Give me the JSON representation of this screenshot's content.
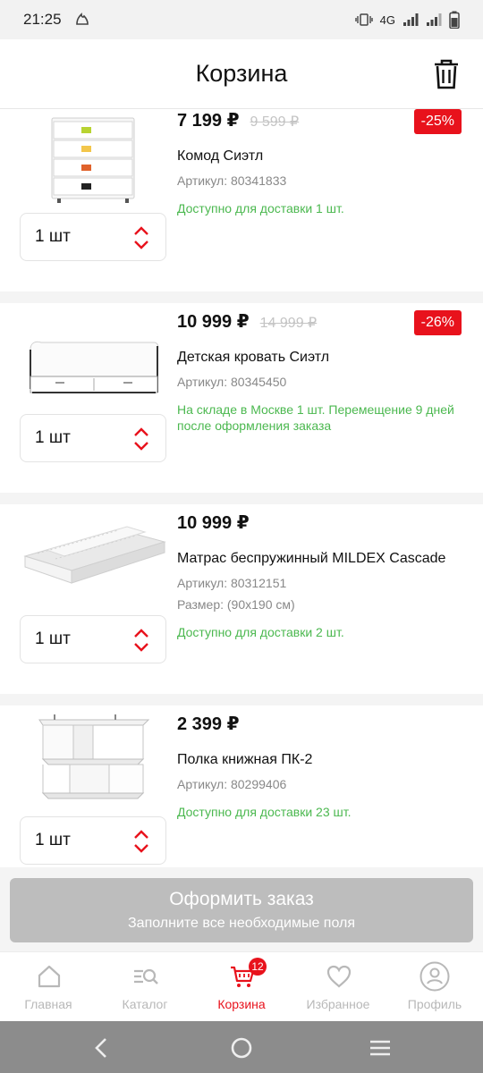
{
  "status_bar": {
    "time": "21:25",
    "network": "4G"
  },
  "header": {
    "title": "Корзина"
  },
  "items": [
    {
      "price": "7 199 ₽",
      "old_price": "9 599 ₽",
      "discount": "-25%",
      "name": "Комод Сиэтл",
      "article": "Артикул: 80341833",
      "availability": "Доступно для доставки 1 шт.",
      "quantity": "1 шт"
    },
    {
      "price": "10 999 ₽",
      "old_price": "14 999 ₽",
      "discount": "-26%",
      "name": "Детская кровать Сиэтл",
      "article": "Артикул: 80345450",
      "availability": "На складе в Москве 1 шт. Перемещение  9 дней после оформления заказа",
      "quantity": "1 шт"
    },
    {
      "price": "10 999 ₽",
      "name": "Матрас беспружинный MILDEX Cascade",
      "article": "Артикул: 80312151",
      "size": "Размер: (90х190 см)",
      "availability": "Доступно для доставки 2 шт.",
      "quantity": "1 шт"
    },
    {
      "price": "2 399 ₽",
      "name": "Полка книжная ПК-2",
      "article": "Артикул: 80299406",
      "availability": "Доступно для доставки 23 шт.",
      "quantity": "1 шт"
    }
  ],
  "order_button": {
    "label": "Оформить заказ",
    "sublabel": "Заполните все необходимые поля"
  },
  "nav": {
    "items": [
      {
        "label": "Главная",
        "icon": "home-icon"
      },
      {
        "label": "Каталог",
        "icon": "catalog-icon"
      },
      {
        "label": "Корзина",
        "icon": "cart-icon",
        "badge": "12",
        "active": true
      },
      {
        "label": "Избранное",
        "icon": "heart-icon"
      },
      {
        "label": "Профиль",
        "icon": "profile-icon"
      }
    ]
  },
  "colors": {
    "accent": "#e8121c",
    "available": "#4bb84f",
    "disabled_button": "#bdbdbd"
  }
}
